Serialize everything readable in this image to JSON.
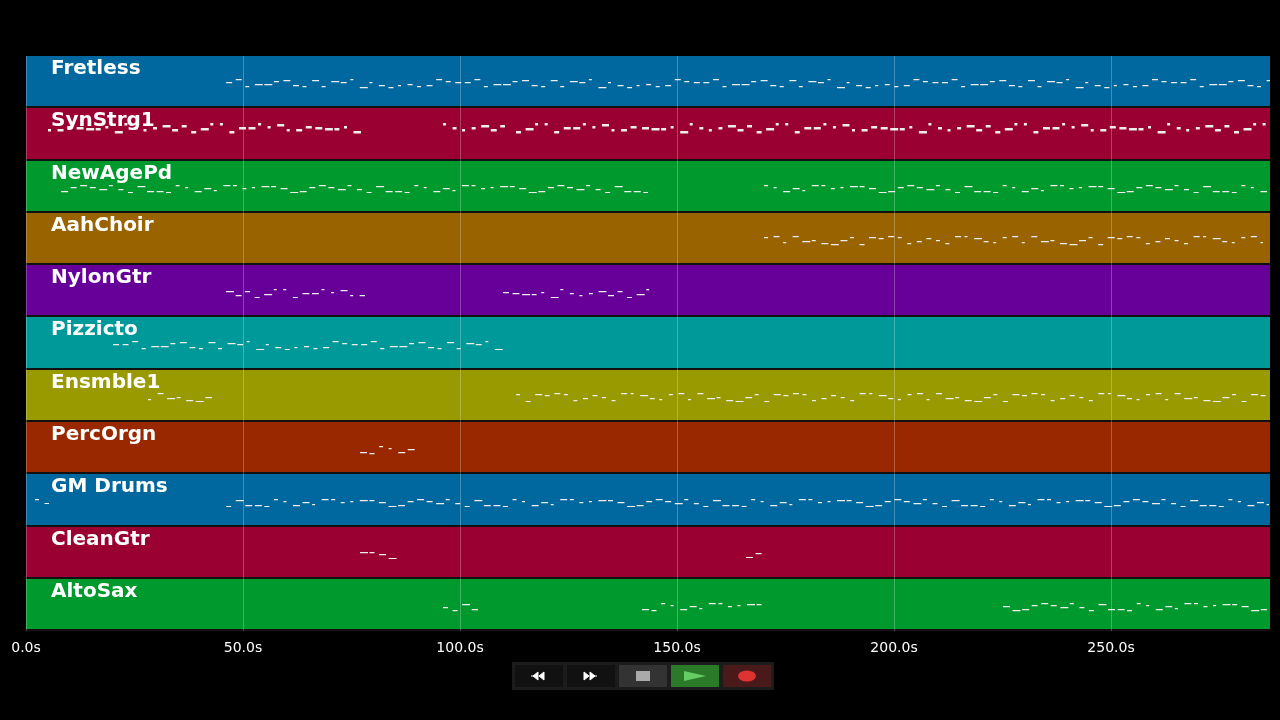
{
  "tracks": [
    {
      "name": "Fretless",
      "color": "#00689e"
    },
    {
      "name": "SynStrg1",
      "color": "#9a0032"
    },
    {
      "name": "NewAgePd",
      "color": "#00992e"
    },
    {
      "name": "AahChoir",
      "color": "#996300"
    },
    {
      "name": "NylonGtr",
      "color": "#660099"
    },
    {
      "name": "Pizzicto",
      "color": "#009999"
    },
    {
      "name": "Ensmble1",
      "color": "#999900"
    },
    {
      "name": "PercOrgn",
      "color": "#992800"
    },
    {
      "name": "GM Drums",
      "color": "#00689e"
    },
    {
      "name": "CleanGtr",
      "color": "#9a0032"
    },
    {
      "name": "AltoSax",
      "color": "#00992e"
    }
  ],
  "time_axis": {
    "ticks": [
      "0.0s",
      "50.0s",
      "100.0s",
      "150.0s",
      "200.0s",
      "250.0s"
    ]
  },
  "transport": [
    {
      "kind": "rewind"
    },
    {
      "kind": "forward"
    },
    {
      "kind": "stop"
    },
    {
      "kind": "play"
    },
    {
      "kind": "record"
    }
  ]
}
